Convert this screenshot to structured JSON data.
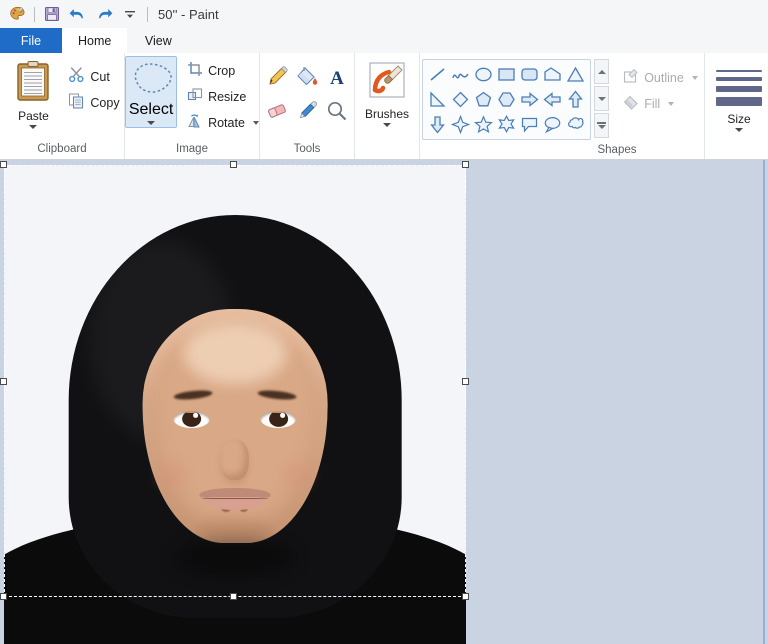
{
  "window": {
    "title": "50'' - Paint",
    "quick_access": [
      {
        "name": "paint-app-icon",
        "label": "Paint"
      },
      {
        "name": "save-icon",
        "label": "Save"
      },
      {
        "name": "undo-icon",
        "label": "Undo"
      },
      {
        "name": "redo-icon",
        "label": "Redo"
      },
      {
        "name": "customize-quick-access-icon",
        "label": "Customize Quick Access Toolbar"
      }
    ]
  },
  "tabs": [
    {
      "label": "File",
      "type": "file"
    },
    {
      "label": "Home",
      "type": "active"
    },
    {
      "label": "View",
      "type": "normal"
    }
  ],
  "ribbon": {
    "clipboard": {
      "label": "Clipboard",
      "paste": "Paste",
      "cut": "Cut",
      "copy": "Copy"
    },
    "image": {
      "label": "Image",
      "select": "Select",
      "crop": "Crop",
      "resize": "Resize",
      "rotate": "Rotate"
    },
    "tools": {
      "label": "Tools",
      "items": [
        {
          "name": "pencil-icon",
          "label": "Pencil"
        },
        {
          "name": "fill-with-color-icon",
          "label": "Fill with color"
        },
        {
          "name": "text-icon",
          "label": "Text"
        },
        {
          "name": "eraser-icon",
          "label": "Eraser"
        },
        {
          "name": "color-picker-icon",
          "label": "Color picker"
        },
        {
          "name": "magnifier-icon",
          "label": "Magnifier"
        }
      ]
    },
    "brushes": {
      "label": "Brushes"
    },
    "shapes": {
      "label": "Shapes",
      "items": [
        "line",
        "curve",
        "oval",
        "rectangle",
        "rounded-rectangle",
        "polygon",
        "triangle",
        "right-triangle",
        "diamond",
        "pentagon",
        "hexagon",
        "right-arrow",
        "left-arrow",
        "up-arrow",
        "down-arrow",
        "four-point-star",
        "five-point-star",
        "six-point-star",
        "rounded-callout",
        "oval-callout",
        "cloud-callout"
      ],
      "scroll_up": "Scroll up",
      "scroll_down": "Scroll down",
      "more": "More shapes"
    },
    "outline_fill": {
      "outline": "Outline",
      "fill": "Fill",
      "outline_disabled": true,
      "fill_disabled": true
    },
    "size": {
      "label": "Size"
    }
  },
  "canvas": {
    "selection_active": true,
    "image_alt": "Portrait photo of a person wearing a black hijab on a light background",
    "workspace_color": "#c9d3e1",
    "canvas_color": "#f2f4f8",
    "selection_border_color": "#1b6fc4"
  },
  "colors": {
    "accent": "#1e6cc7",
    "ribbon_bg": "#ffffff",
    "titlebar_bg": "#f5f6f7",
    "disabled_text": "#a8adb3"
  }
}
